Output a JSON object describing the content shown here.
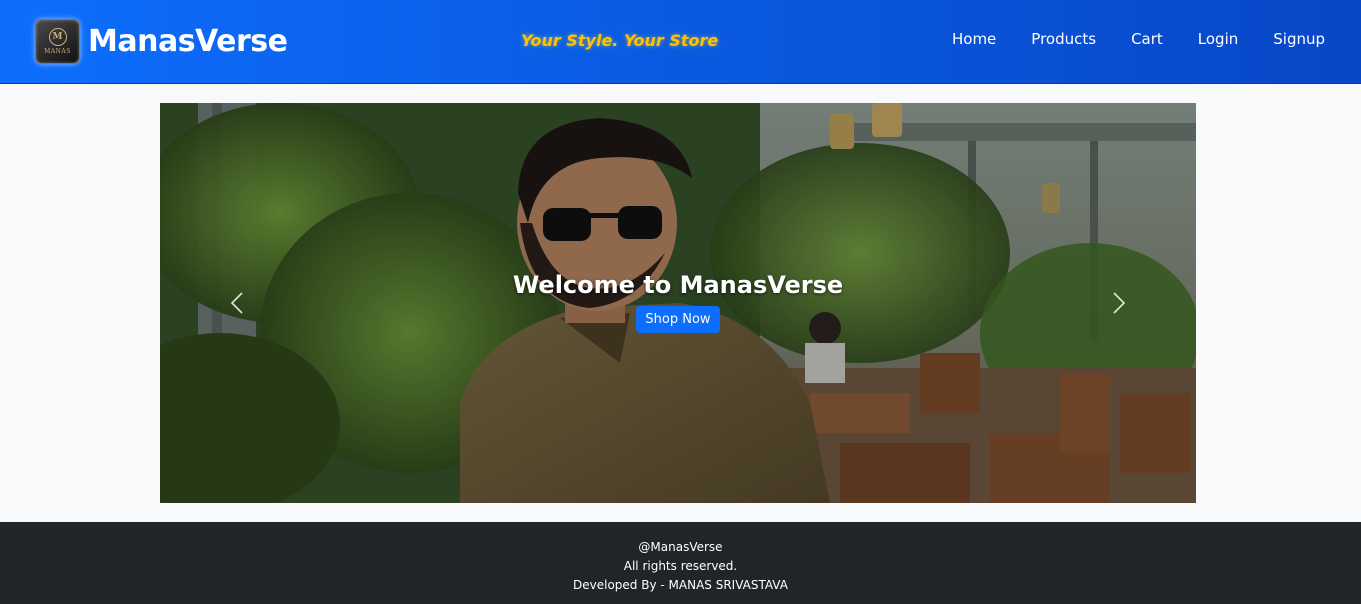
{
  "navbar": {
    "brand_name": "ManasVerse",
    "logo_text": "MANAS",
    "tagline": "Your Style. Your Store",
    "links": [
      "Home",
      "Products",
      "Cart",
      "Login",
      "Signup"
    ]
  },
  "carousel": {
    "caption_title": "Welcome to ManasVerse",
    "cta_label": "Shop Now",
    "prev_icon": "chevron-left-icon",
    "next_icon": "chevron-right-icon"
  },
  "footer": {
    "handle": "@ManasVerse",
    "rights": "All rights reserved.",
    "credit": "Developed By - MANAS SRIVASTAVA"
  },
  "colors": {
    "primary": "#0d6efd",
    "accent": "#ffc107",
    "footer_bg": "#212529",
    "page_bg": "#f8f9fa"
  }
}
